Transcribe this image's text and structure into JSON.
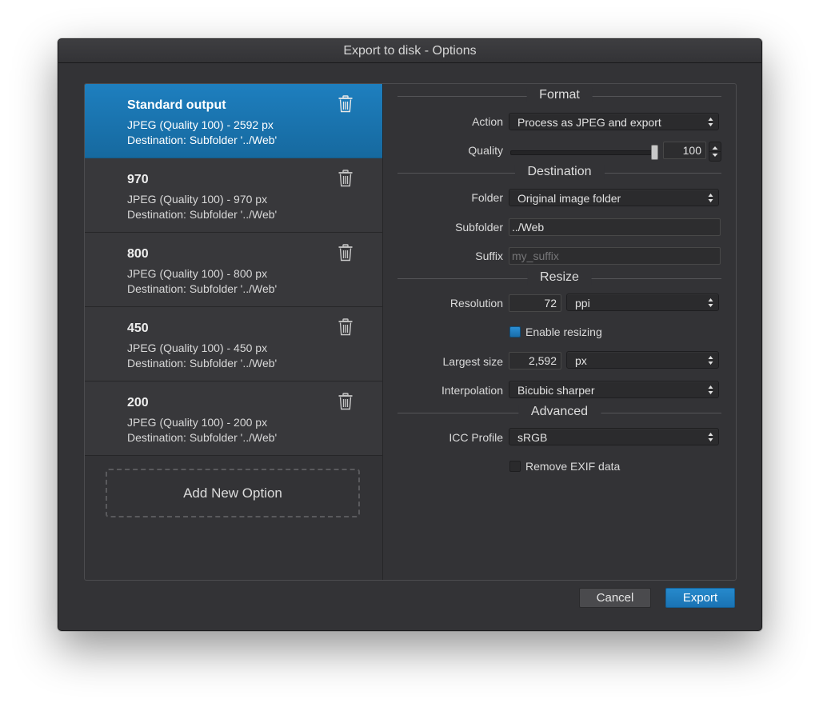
{
  "window": {
    "title": "Export to disk - Options"
  },
  "options": [
    {
      "title": "Standard output",
      "line1": "JPEG (Quality 100) - 2592 px",
      "line2": "Destination: Subfolder '../Web'",
      "selected": true
    },
    {
      "title": "970",
      "line1": "JPEG (Quality 100) - 970 px",
      "line2": "Destination: Subfolder '../Web'",
      "selected": false
    },
    {
      "title": "800",
      "line1": "JPEG (Quality 100) - 800 px",
      "line2": "Destination: Subfolder '../Web'",
      "selected": false
    },
    {
      "title": "450",
      "line1": "JPEG (Quality 100) - 450 px",
      "line2": "Destination: Subfolder '../Web'",
      "selected": false
    },
    {
      "title": "200",
      "line1": "JPEG (Quality 100) - 200 px",
      "line2": "Destination: Subfolder '../Web'",
      "selected": false
    }
  ],
  "add_option_label": "Add New Option",
  "format": {
    "section": "Format",
    "action_label": "Action",
    "action_value": "Process as JPEG and export",
    "quality_label": "Quality",
    "quality_value": "100"
  },
  "destination": {
    "section": "Destination",
    "folder_label": "Folder",
    "folder_value": "Original image folder",
    "subfolder_label": "Subfolder",
    "subfolder_value": "../Web",
    "suffix_label": "Suffix",
    "suffix_placeholder": "my_suffix"
  },
  "resize": {
    "section": "Resize",
    "resolution_label": "Resolution",
    "resolution_value": "72",
    "resolution_unit": "ppi",
    "enable_resizing_label": "Enable resizing",
    "enable_resizing_checked": true,
    "largest_size_label": "Largest size",
    "largest_size_value": "2,592",
    "largest_size_unit": "px",
    "interpolation_label": "Interpolation",
    "interpolation_value": "Bicubic sharper"
  },
  "advanced": {
    "section": "Advanced",
    "icc_label": "ICC Profile",
    "icc_value": "sRGB",
    "remove_exif_label": "Remove EXIF data",
    "remove_exif_checked": false
  },
  "buttons": {
    "cancel": "Cancel",
    "export": "Export"
  },
  "colors": {
    "accent": "#1b78b8",
    "background": "#333336"
  },
  "icons": {
    "trash": "trash-icon",
    "select_arrows": "updown-arrows-icon"
  }
}
